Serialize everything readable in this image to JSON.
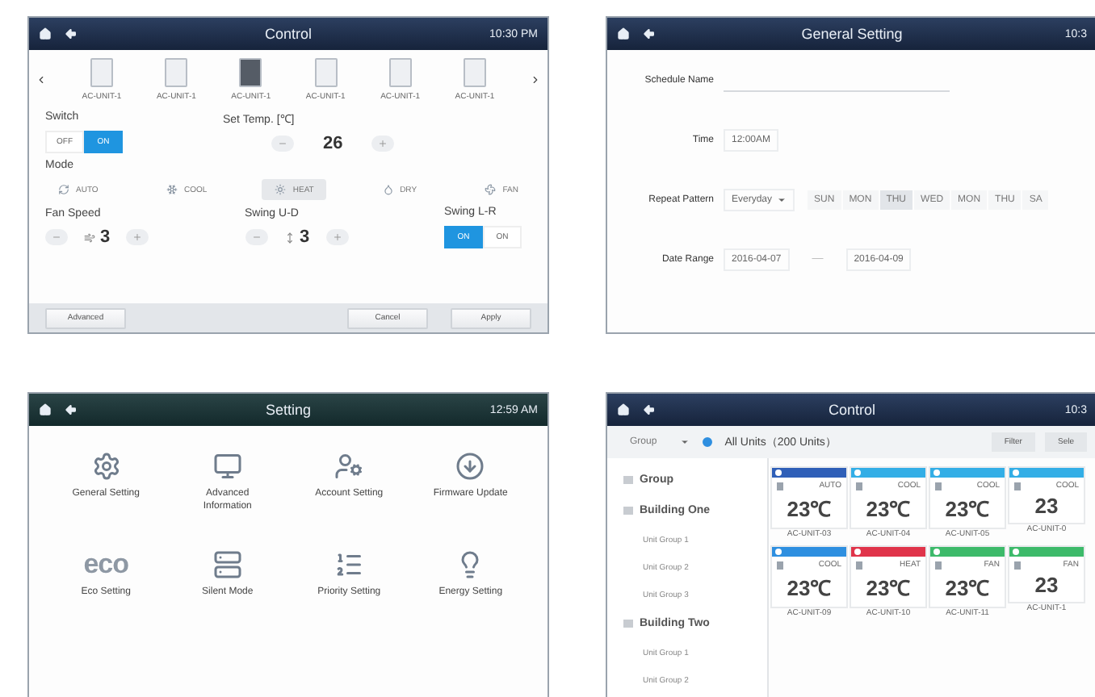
{
  "control_panel": {
    "title": "Control",
    "time": "10:30 PM",
    "units": [
      {
        "name": "AC-UNIT-1",
        "selected": false
      },
      {
        "name": "AC-UNIT-1",
        "selected": false
      },
      {
        "name": "AC-UNIT-1",
        "selected": true
      },
      {
        "name": "AC-UNIT-1",
        "selected": false
      },
      {
        "name": "AC-UNIT-1",
        "selected": false
      },
      {
        "name": "AC-UNIT-1",
        "selected": false
      }
    ],
    "switch": {
      "label": "Switch",
      "options": [
        {
          "label": "OFF",
          "selected": false
        },
        {
          "label": "ON",
          "selected": true
        }
      ]
    },
    "set_temp": {
      "label": "Set Temp. [℃]",
      "value": "26"
    },
    "mode": {
      "label": "Mode",
      "options": [
        {
          "label": "AUTO",
          "kind": "auto",
          "selected": false
        },
        {
          "label": "COOL",
          "kind": "cool",
          "selected": false
        },
        {
          "label": "HEAT",
          "kind": "heat",
          "selected": true
        },
        {
          "label": "DRY",
          "kind": "dry",
          "selected": false
        },
        {
          "label": "FAN",
          "kind": "fan",
          "selected": false
        }
      ]
    },
    "fan_speed": {
      "label": "Fan Speed",
      "value": "3"
    },
    "swing_ud": {
      "label": "Swing U-D",
      "value": "3"
    },
    "swing_lr": {
      "label": "Swing L-R",
      "options": [
        {
          "label": "ON",
          "selected": true
        },
        {
          "label": "ON",
          "selected": false
        }
      ]
    },
    "buttons": [
      {
        "label": "Advanced",
        "kind": "left"
      },
      {
        "label": "Cancel",
        "kind": "right"
      },
      {
        "label": "Apply",
        "kind": "right"
      }
    ]
  },
  "general_setting": {
    "title": "General Setting",
    "time": "10:3",
    "schedule_name": {
      "label": "Schedule Name"
    },
    "time_field": {
      "label": "Time",
      "value": "12:00AM"
    },
    "repeat_pattern": {
      "label": "Repeat Pattern",
      "value": "Everyday",
      "days": [
        {
          "label": "SUN",
          "selected": false
        },
        {
          "label": "MON",
          "selected": false
        },
        {
          "label": "THU",
          "selected": true
        },
        {
          "label": "WED",
          "selected": false
        },
        {
          "label": "MON",
          "selected": false
        },
        {
          "label": "THU",
          "selected": false
        },
        {
          "label": "SA",
          "selected": false
        }
      ]
    },
    "date_range": {
      "label": "Date Range",
      "from": "2016-04-07",
      "separator": "—",
      "to": "2016-04-09"
    }
  },
  "setting_panel": {
    "title": "Setting",
    "time": "12:59 AM",
    "items": [
      {
        "label": "General Setting",
        "kind": "gear"
      },
      {
        "label": "Advanced Information",
        "kind": "monitor"
      },
      {
        "label": "Account Setting",
        "kind": "account"
      },
      {
        "label": "Firmware Update",
        "kind": "download"
      },
      {
        "label": "Eco Setting",
        "kind": "eco",
        "icon_text": "eco"
      },
      {
        "label": "Silent Mode",
        "kind": "server"
      },
      {
        "label": "Priority Setting",
        "kind": "priority"
      },
      {
        "label": "Energy Setting",
        "kind": "bulb"
      }
    ]
  },
  "unit_control": {
    "title": "Control",
    "time": "10:3",
    "group_dropdown": "Group",
    "all_units": {
      "label": "All Units（200 Units）",
      "checked": true
    },
    "buttons": [
      "Filter",
      "Sele"
    ],
    "tree": [
      {
        "label": "Group"
      },
      {
        "label": "Building One",
        "children": [
          {
            "label": "Unit Group 1"
          },
          {
            "label": "Unit Group 2"
          },
          {
            "label": "Unit Group 3"
          }
        ]
      },
      {
        "label": "Building Two",
        "children": [
          {
            "label": "Unit Group 1"
          },
          {
            "label": "Unit Group 2"
          }
        ]
      }
    ],
    "cards": [
      {
        "mode": "AUTO",
        "temp": "23℃",
        "name": "AC-UNIT-03",
        "color": "#2f5fb8"
      },
      {
        "mode": "COOL",
        "temp": "23℃",
        "name": "AC-UNIT-04",
        "color": "#33aee6"
      },
      {
        "mode": "COOL",
        "temp": "23℃",
        "name": "AC-UNIT-05",
        "color": "#33aee6"
      },
      {
        "mode": "COOL",
        "temp": "23",
        "name": "AC-UNIT-0",
        "color": "#33aee6"
      },
      {
        "mode": "COOL",
        "temp": "23℃",
        "name": "AC-UNIT-09",
        "color": "#2e8fe0"
      },
      {
        "mode": "HEAT",
        "temp": "23℃",
        "name": "AC-UNIT-10",
        "color": "#e0344a"
      },
      {
        "mode": "FAN",
        "temp": "23℃",
        "name": "AC-UNIT-11",
        "color": "#3dba6a"
      },
      {
        "mode": "FAN",
        "temp": "23",
        "name": "AC-UNIT-1",
        "color": "#3dba6a"
      }
    ]
  }
}
